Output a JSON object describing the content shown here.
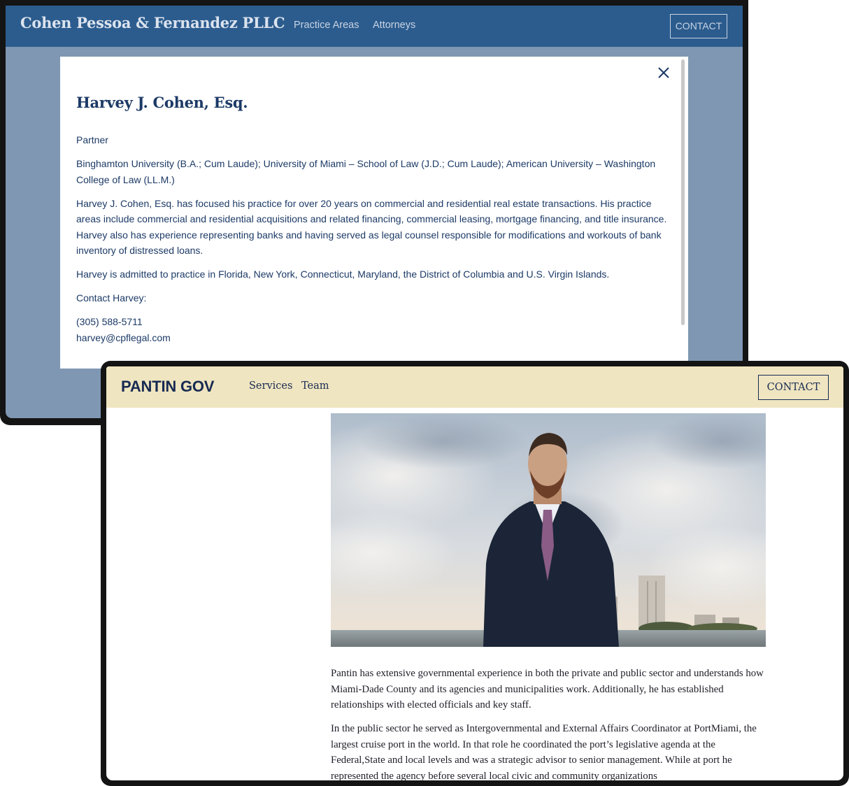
{
  "cohen_site": {
    "header": {
      "logo": "Cohen Pessoa & Fernandez PLLC",
      "nav": [
        "Practice Areas",
        "Attorneys"
      ],
      "contact_label": "CONTACT"
    },
    "modal": {
      "name": "Harvey J. Cohen, Esq.",
      "title": "Partner",
      "education": "Binghamton University (B.A.; Cum Laude); University of Miami – School of Law (J.D.; Cum Laude); American University – Washington College of Law (LL.M.)",
      "bio": "Harvey J. Cohen, Esq. has focused his practice for over 20 years on commercial and residential real estate transactions. His practice areas include commercial and residential acquisitions and related financing, commercial leasing, mortgage financing, and title insurance. Harvey also has experience representing banks and having served as legal counsel responsible for modifications and workouts of bank inventory of distressed loans.",
      "admissions": "Harvey is admitted to practice in Florida, New York, Connecticut, Maryland, the District of Columbia and U.S. Virgin Islands.",
      "contact_heading": "Contact Harvey:",
      "phone": "(305) 588-5711",
      "email": "harvey@cpflegal.com"
    }
  },
  "pantin_site": {
    "header": {
      "logo": "PANTIN GOV",
      "nav": [
        "Services",
        "Team"
      ],
      "contact_label": "CONTACT"
    },
    "photo_alt": "man-in-suit-waterfront-photo",
    "paragraphs": [
      "Pantin has extensive governmental experience in both the private and public sector and understands how Miami-Dade County and its agencies and municipalities work. Additionally, he has established relationships with elected officials and key staff.",
      "In the public sector he served as Intergovernmental and External Affairs Coordinator at PortMiami, the largest cruise port in the world. In that role he coordinated the port’s legislative agenda at the Federal,State and local levels and was a strategic advisor to senior management. While at port he represented the agency before several local civic and community organizations"
    ]
  },
  "colors": {
    "cohen_header": "#2c5c8e",
    "cohen_overlay": "#7f97b3",
    "cohen_text": "#1c3a66",
    "pantin_header": "#efe5c0",
    "pantin_text": "#182a52",
    "device_frame": "#141414"
  },
  "icons": [
    "close-icon"
  ]
}
